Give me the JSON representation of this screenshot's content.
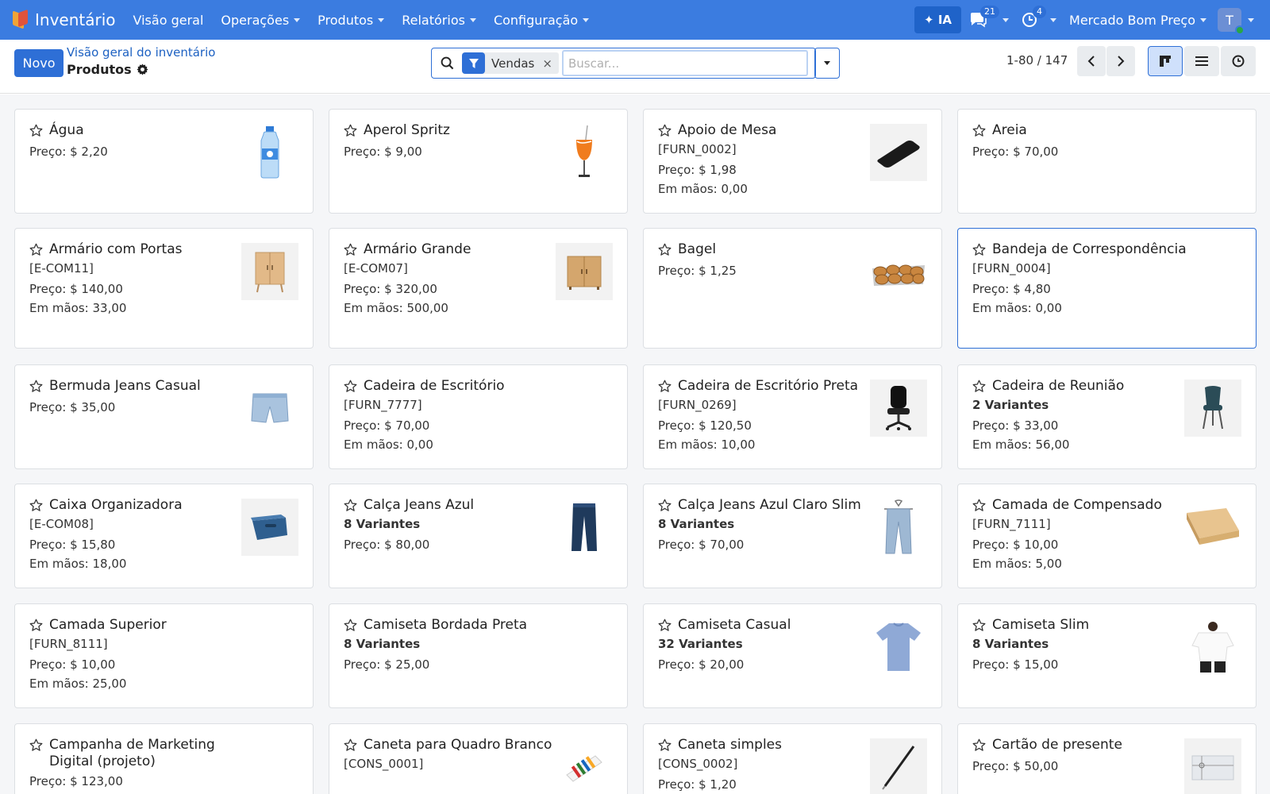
{
  "navbar": {
    "app_name": "Inventário",
    "menu": [
      "Visão geral",
      "Operações",
      "Produtos",
      "Relatórios",
      "Configuração"
    ],
    "ia_label": "✦ IA",
    "messages_count": "21",
    "activities_count": "4",
    "company": "Mercado Bom Preço",
    "user_initial": "T"
  },
  "control": {
    "new_label": "Novo",
    "breadcrumb": "Visão geral do inventário",
    "title": "Produtos",
    "facet_label": "Vendas",
    "facet_close": "×",
    "search_placeholder": "Buscar...",
    "pager": "1-80 / 147"
  },
  "labels": {
    "price": "Preço: ",
    "stock": "Em mãos: "
  },
  "products": [
    {
      "name": "Água",
      "price": "$ 2,20",
      "image": "water-bottle"
    },
    {
      "name": "Aperol Spritz",
      "price": "$ 9,00",
      "image": "cocktail-glass"
    },
    {
      "name": "Apoio de Mesa",
      "ref": "[FURN_0002]",
      "price": "$ 1,98",
      "stock": "0,00",
      "image": "desk-pad"
    },
    {
      "name": "Areia",
      "price": "$ 70,00"
    },
    {
      "name": "Armário com Portas",
      "ref": "[E-COM11]",
      "price": "$ 140,00",
      "stock": "33,00",
      "image": "cabinet"
    },
    {
      "name": "Armário Grande",
      "ref": "[E-COM07]",
      "price": "$ 320,00",
      "stock": "500,00",
      "image": "large-cabinet"
    },
    {
      "name": "Bagel",
      "price": "$ 1,25",
      "image": "bagels-tray"
    },
    {
      "name": "Bandeja de Correspondência",
      "ref": "[FURN_0004]",
      "price": "$ 4,80",
      "stock": "0,00",
      "selected": true
    },
    {
      "name": "Bermuda Jeans Casual",
      "price": "$ 35,00",
      "image": "denim-shorts"
    },
    {
      "name": "Cadeira de Escritório",
      "ref": "[FURN_7777]",
      "price": "$ 70,00",
      "stock": "0,00"
    },
    {
      "name": "Cadeira de Escritório Preta",
      "ref": "[FURN_0269]",
      "price": "$ 120,50",
      "stock": "10,00",
      "image": "office-chair"
    },
    {
      "name": "Cadeira de Reunião",
      "variants": "2 Variantes",
      "price": "$ 33,00",
      "stock": "56,00",
      "image": "meeting-chair"
    },
    {
      "name": "Caixa Organizadora",
      "ref": "[E-COM08]",
      "price": "$ 15,80",
      "stock": "18,00",
      "image": "storage-box"
    },
    {
      "name": "Calça Jeans Azul",
      "variants": "8 Variantes",
      "price": "$ 80,00",
      "image": "jeans"
    },
    {
      "name": "Calça Jeans Azul Claro Slim",
      "variants": "8 Variantes",
      "price": "$ 70,00",
      "image": "light-jeans"
    },
    {
      "name": "Camada de Compensado",
      "ref": "[FURN_7111]",
      "price": "$ 10,00",
      "stock": "5,00",
      "image": "plywood"
    },
    {
      "name": "Camada Superior",
      "ref": "[FURN_8111]",
      "price": "$ 10,00",
      "stock": "25,00"
    },
    {
      "name": "Camiseta Bordada Preta",
      "variants": "8 Variantes",
      "price": "$ 25,00"
    },
    {
      "name": "Camiseta Casual",
      "variants": "32 Variantes",
      "price": "$ 20,00",
      "image": "tshirt-blue"
    },
    {
      "name": "Camiseta Slim",
      "variants": "8 Variantes",
      "price": "$ 15,00",
      "image": "tshirt-white"
    },
    {
      "name": "Campanha de Marketing Digital (projeto)",
      "price": "$ 123,00"
    },
    {
      "name": "Caneta para Quadro Branco",
      "ref": "[CONS_0001]",
      "price": "",
      "image": "markers"
    },
    {
      "name": "Caneta simples",
      "ref": "[CONS_0002]",
      "price": "$ 1,20",
      "image": "pen"
    },
    {
      "name": "Cartão de presente",
      "price": "$ 50,00",
      "image": "gift-card"
    }
  ]
}
